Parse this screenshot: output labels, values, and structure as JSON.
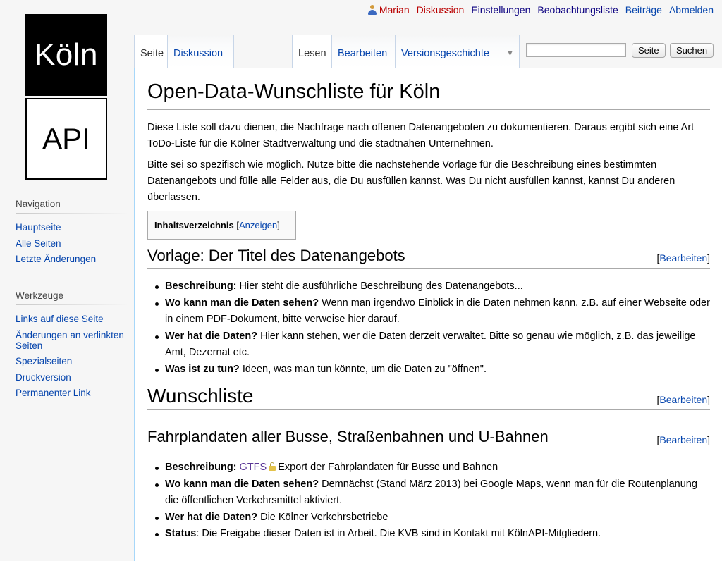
{
  "logo": {
    "top_text": "Köln",
    "bottom_text": "API"
  },
  "personal": {
    "user": "Marian",
    "discussion": "Diskussion",
    "settings": "Einstellungen",
    "watchlist": "Beobachtungsliste",
    "contributions": "Beiträge",
    "logout": "Abmelden"
  },
  "tabs": {
    "page": "Seite",
    "discussion": "Diskussion",
    "read": "Lesen",
    "edit": "Bearbeiten",
    "history": "Versionsgeschichte",
    "more": "▼"
  },
  "search": {
    "value": "",
    "go_label": "Seite",
    "search_label": "Suchen"
  },
  "sidebar": {
    "navigation": {
      "heading": "Navigation",
      "items": [
        "Hauptseite",
        "Alle Seiten",
        "Letzte Änderungen"
      ]
    },
    "tools": {
      "heading": "Werkzeuge",
      "items": [
        "Links auf diese Seite",
        "Änderungen an verlinkten Seiten",
        "Spezialseiten",
        "Druckversion",
        "Permanenter Link"
      ]
    }
  },
  "page": {
    "title": "Open-Data-Wunschliste für Köln",
    "intro1": "Diese Liste soll dazu dienen, die Nachfrage nach offenen Datenangeboten zu dokumentieren. Daraus ergibt sich eine Art ToDo-Liste für die Kölner Stadtverwaltung und die stadtnahen Unternehmen.",
    "intro2": "Bitte sei so spezifisch wie möglich. Nutze bitte die nachstehende Vorlage für die Beschreibung eines bestimmten Datenangebots und fülle alle Felder aus, die Du ausfüllen kannst. Was Du nicht ausfüllen kannst, kannst Du anderen überlassen.",
    "toc": {
      "title": "Inhaltsverzeichnis",
      "open": "[",
      "toggle": "Anzeigen",
      "close": "]"
    },
    "edit_open": "[",
    "edit_label": "Bearbeiten",
    "edit_close": "]",
    "section_template": {
      "title": "Vorlage: Der Titel des Datenangebots",
      "items": [
        {
          "label": "Beschreibung:",
          "text": " Hier steht die ausführliche Beschreibung des Datenangebots..."
        },
        {
          "label": "Wo kann man die Daten sehen?",
          "text": " Wenn man irgendwo Einblick in die Daten nehmen kann, z.B. auf einer Webseite oder in einem PDF-Dokument, bitte verweise hier darauf."
        },
        {
          "label": "Wer hat die Daten?",
          "text": " Hier kann stehen, wer die Daten derzeit verwaltet. Bitte so genau wie möglich, z.B. das jeweilige Amt, Dezernat etc."
        },
        {
          "label": "Was ist zu tun?",
          "text": " Ideen, was man tun könnte, um die Daten zu \"öffnen\"."
        }
      ]
    },
    "section_wishlist": {
      "title": "Wunschliste"
    },
    "section_transit": {
      "title": "Fahrplandaten aller Busse, Straßenbahnen und U-Bahnen",
      "items": [
        {
          "label": "Beschreibung:",
          "link": "GTFS",
          "text": "Export der Fahrplandaten für Busse und Bahnen"
        },
        {
          "label": "Wo kann man die Daten sehen?",
          "text": " Demnächst (Stand März 2013) bei Google Maps, wenn man für die Routenplanung die öffentlichen Verkehrsmittel aktiviert."
        },
        {
          "label": "Wer hat die Daten?",
          "text": " Die Kölner Verkehrsbetriebe"
        },
        {
          "label": "Status",
          "text": ": Die Freigabe dieser Daten ist in Arbeit. Die KVB sind in Kontakt mit KölnAPI-Mitgliedern."
        }
      ]
    }
  }
}
